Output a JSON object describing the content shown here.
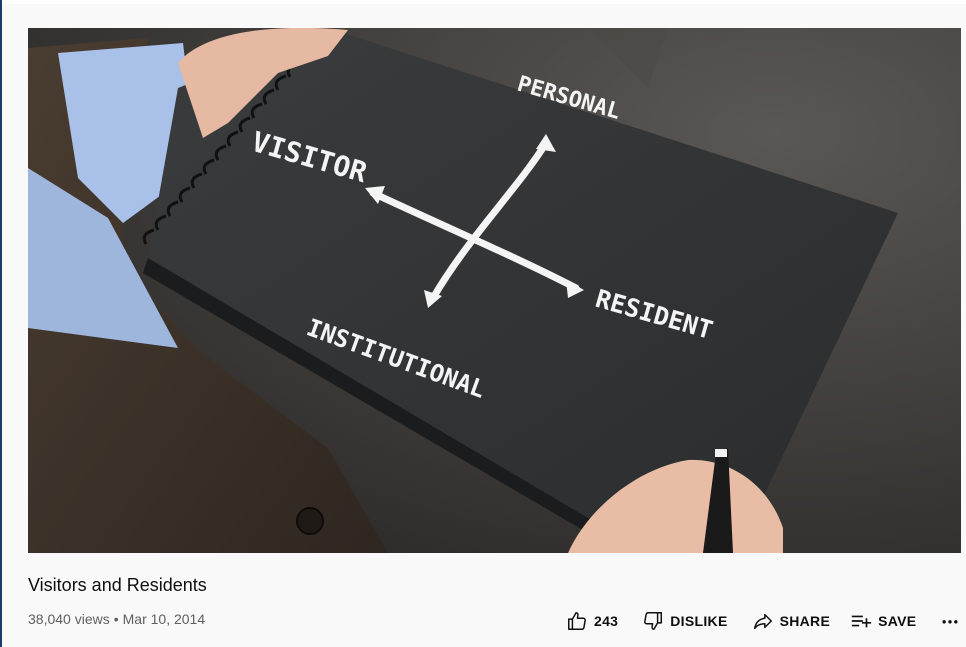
{
  "video": {
    "title": "Visitors and Residents",
    "views": "38,040 views",
    "date": "Mar 10, 2014",
    "frame_text": {
      "top": "PERSONAL",
      "left": "VISITOR",
      "right": "RESIDENT",
      "bottom": "INSTITUTIONAL"
    }
  },
  "actions": {
    "like_count": "243",
    "dislike_label": "DISLIKE",
    "share_label": "SHARE",
    "save_label": "SAVE"
  },
  "icons": {
    "like": "thumbs-up-icon",
    "dislike": "thumbs-down-icon",
    "share": "share-arrow-icon",
    "save": "playlist-add-icon",
    "more": "more-horizontal-icon"
  },
  "colors": {
    "page_bg": "#f9f9f9",
    "text_primary": "#0f0f0f",
    "text_secondary": "#606060"
  }
}
